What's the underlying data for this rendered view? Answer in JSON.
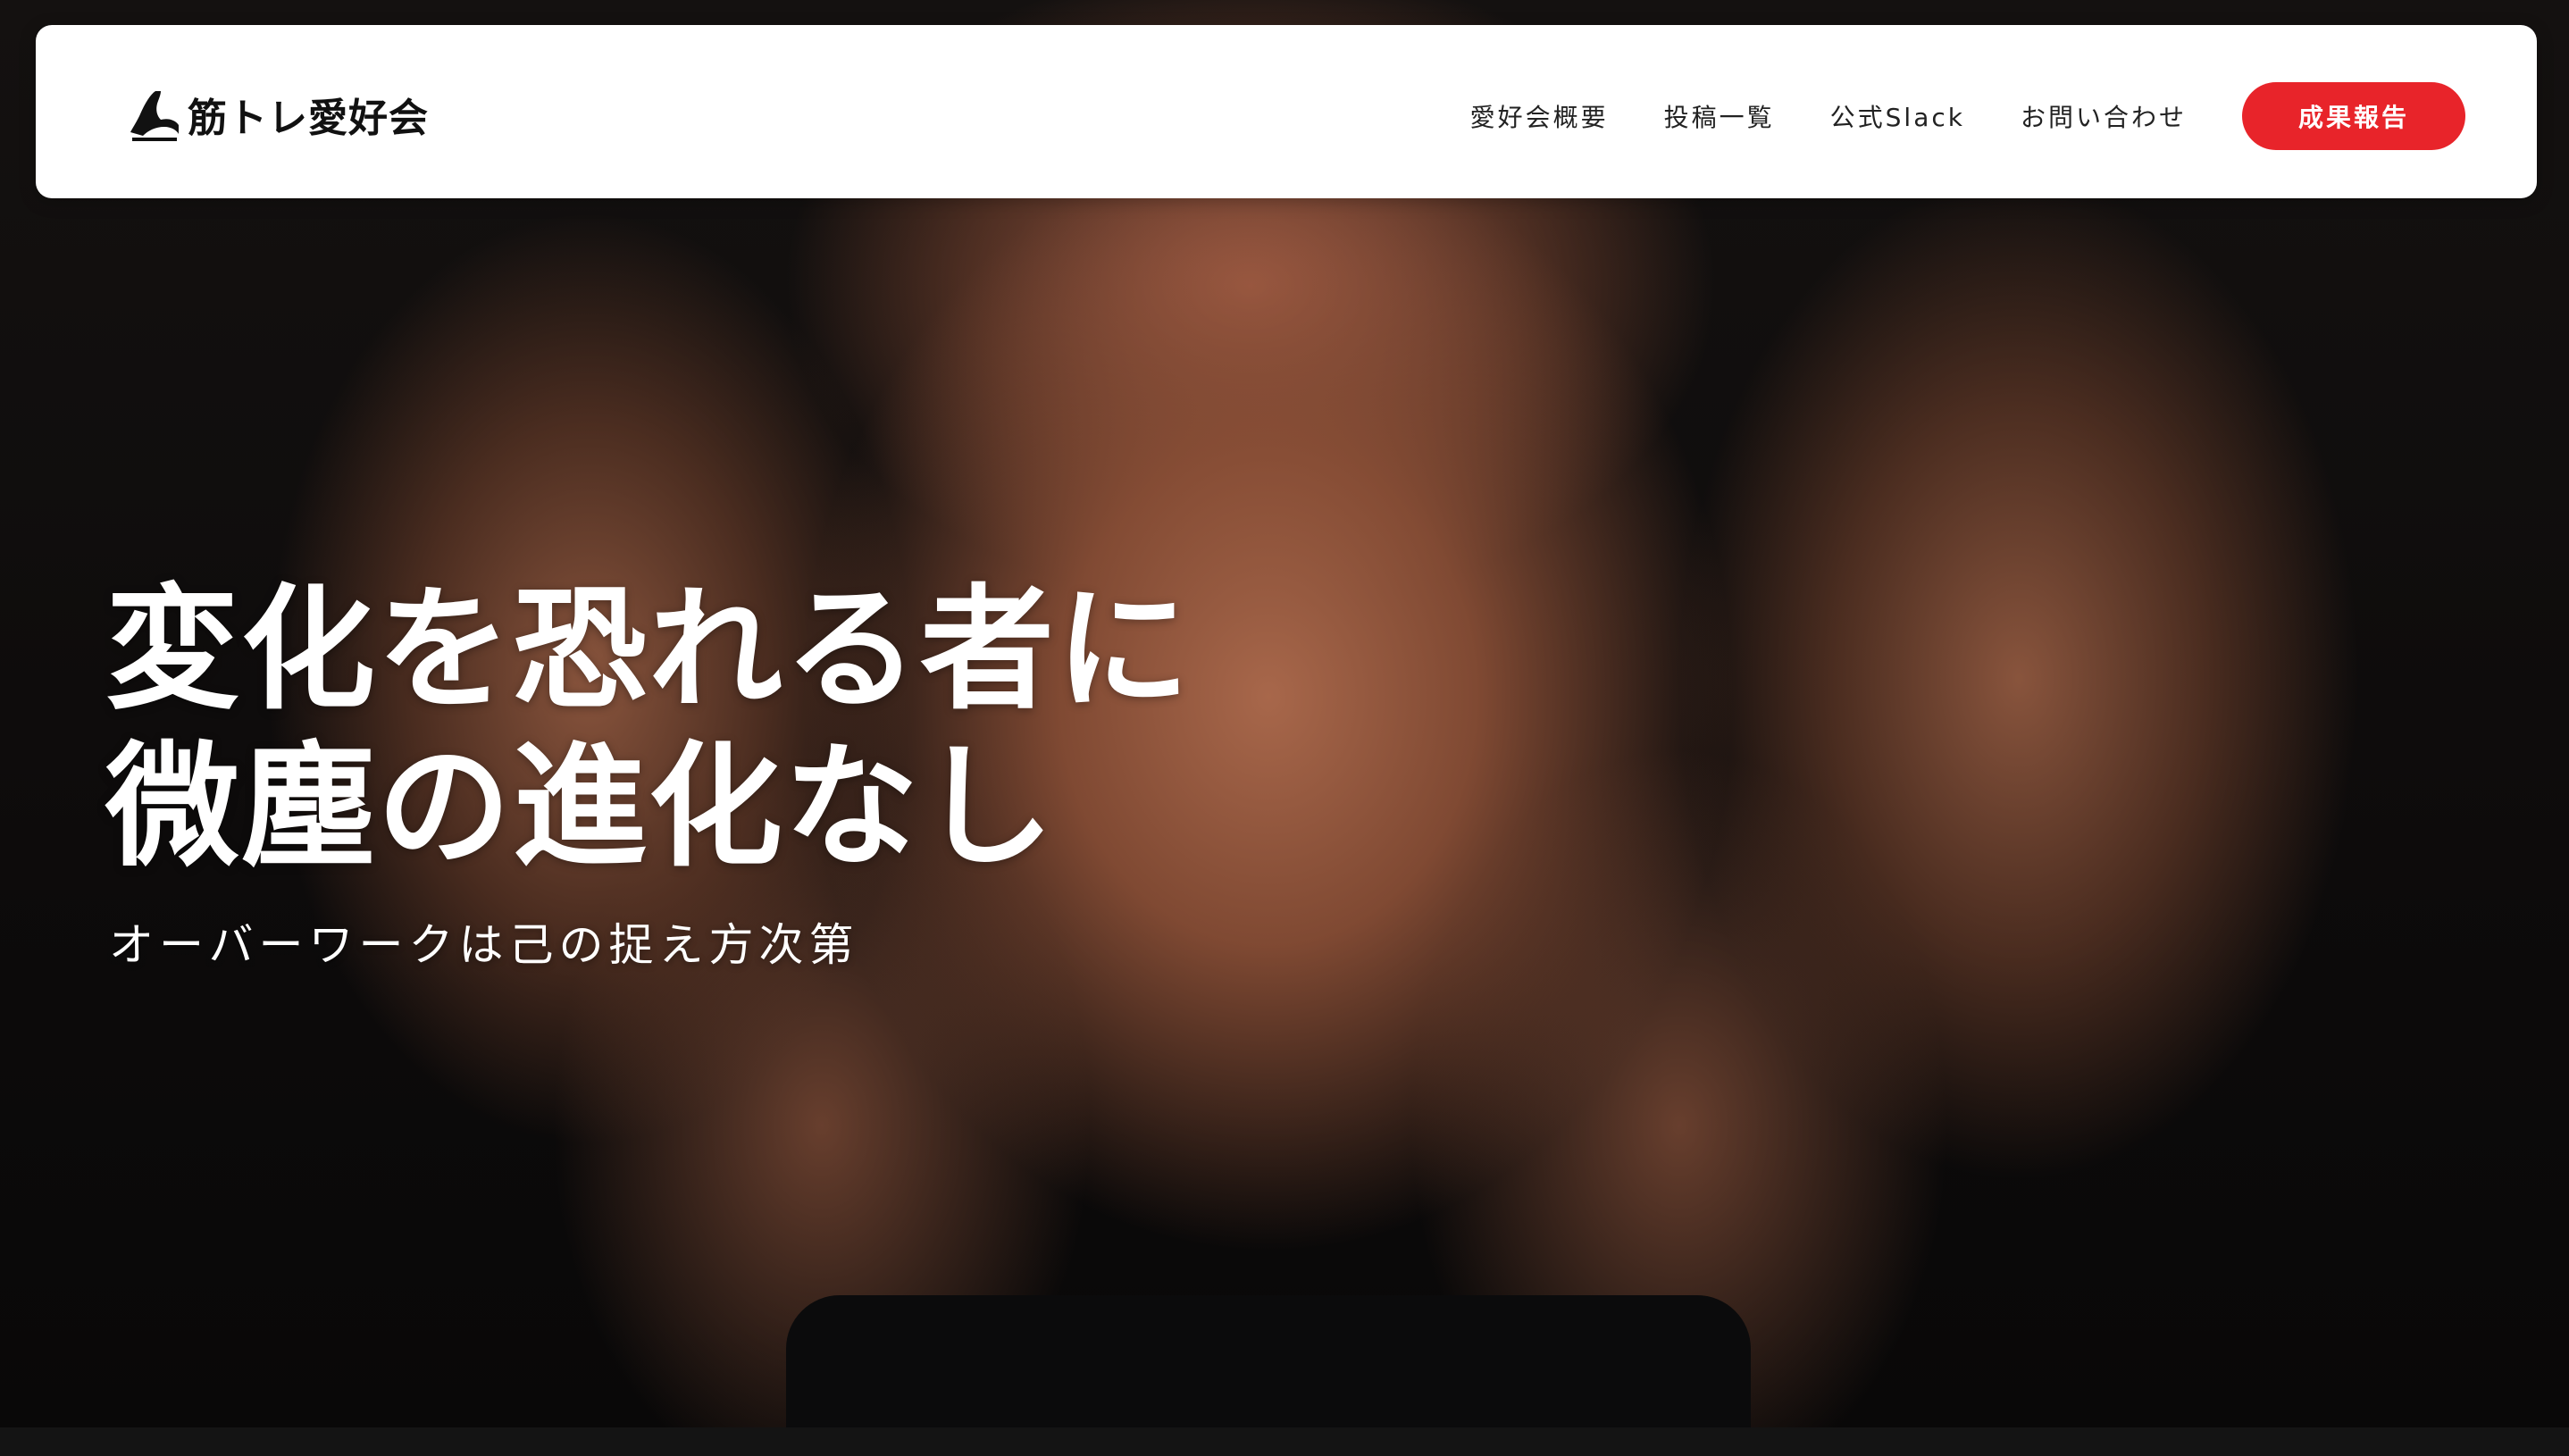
{
  "site": {
    "logo_text": "筋トレ愛好会",
    "logo_icon": "flexing-arm-icon"
  },
  "nav": {
    "items": [
      {
        "label": "愛好会概要"
      },
      {
        "label": "投稿一覧"
      },
      {
        "label": "公式Slack"
      },
      {
        "label": "お問い合わせ"
      }
    ],
    "cta_label": "成果報告"
  },
  "hero": {
    "headline_line1": "変化を恐れる者に",
    "headline_line2": "微塵の進化なし",
    "subtitle": "オーバーワークは己の捉え方次第",
    "background": "muscular-torso-photo"
  },
  "colors": {
    "accent": "#e8242a",
    "header_bg": "#ffffff",
    "hero_text": "#ffffff",
    "page_bg": "#0b0b0b"
  }
}
